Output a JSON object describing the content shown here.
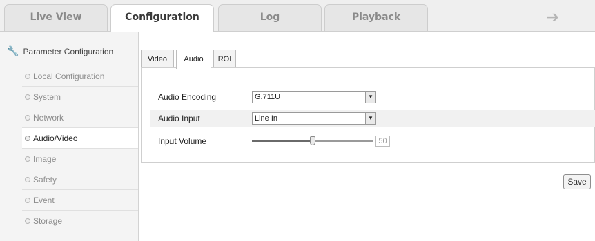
{
  "top_tabs": [
    {
      "label": "Live View"
    },
    {
      "label": "Configuration"
    },
    {
      "label": "Log"
    },
    {
      "label": "Playback"
    }
  ],
  "active_top_tab": "Configuration",
  "sidebar": {
    "title": "Parameter Configuration",
    "items": [
      {
        "label": "Local Configuration"
      },
      {
        "label": "System"
      },
      {
        "label": "Network"
      },
      {
        "label": "Audio/Video"
      },
      {
        "label": "Image"
      },
      {
        "label": "Safety"
      },
      {
        "label": "Event"
      },
      {
        "label": "Storage"
      }
    ],
    "active_item": "Audio/Video"
  },
  "sub_tabs": [
    {
      "label": "Video"
    },
    {
      "label": "Audio"
    },
    {
      "label": "ROI"
    }
  ],
  "active_sub_tab": "Audio",
  "form": {
    "audio_encoding": {
      "label": "Audio Encoding",
      "value": "G.711U"
    },
    "audio_input": {
      "label": "Audio Input",
      "value": "Line In"
    },
    "input_volume": {
      "label": "Input Volume",
      "value": "50",
      "level": 50
    }
  },
  "save_label": "Save",
  "icons": {
    "logout": "arrow-right-icon",
    "params": "wrench-icon"
  },
  "colors": {
    "topbar": "#efefef",
    "sidebar": "#f4f4f4",
    "border": "#cfcfcf"
  }
}
